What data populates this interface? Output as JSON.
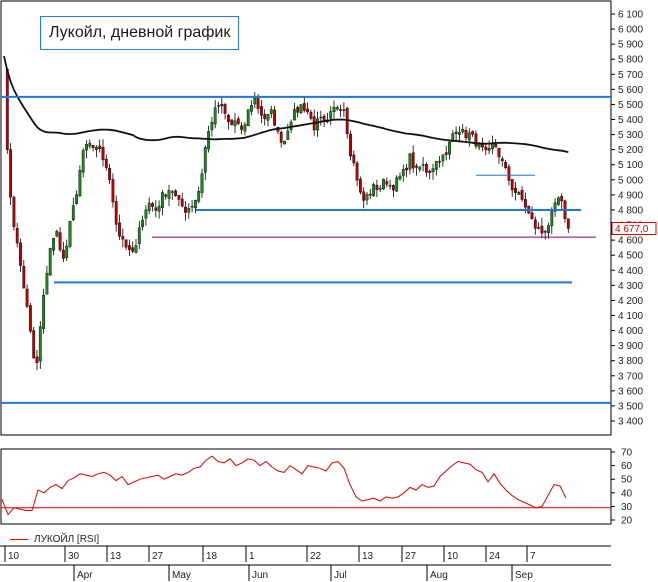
{
  "chart_data": {
    "type": "candlestick",
    "title": "Лукойл, дневной график",
    "price_axis": {
      "ylim": [
        3400,
        6100
      ],
      "ticks": [
        "6 100",
        "6 000",
        "5 900",
        "5 800",
        "5 700",
        "5 600",
        "5 500",
        "5 400",
        "5 300",
        "5 200",
        "5 100",
        "5 000",
        "4 900",
        "4 800",
        "4 700",
        "4 600",
        "4 500",
        "4 400",
        "4 300",
        "4 200",
        "4 100",
        "4 000",
        "3 900",
        "3 800",
        "3 700",
        "3 600",
        "3 500",
        "3 400"
      ],
      "last_price_label": "4 677,0",
      "last_price": 4677
    },
    "rsi_axis": {
      "ylim": [
        20,
        70
      ],
      "ticks": [
        "70",
        "60",
        "50",
        "40",
        "30",
        "20"
      ],
      "level": 29
    },
    "date_axis": {
      "day_labels": [
        "10",
        "30",
        "13",
        "27",
        "18",
        "1",
        "22",
        "13",
        "27",
        "10",
        "24",
        "7"
      ],
      "month_labels": [
        "Apr",
        "May",
        "Jun",
        "Jul",
        "Aug",
        "Sep"
      ]
    },
    "legend": "ЛУКОЙЛ [RSI]",
    "horizontal_levels": [
      5550,
      4800,
      4320,
      3520
    ],
    "short_levels": [
      5030,
      4620
    ],
    "colors": {
      "up": "#1a8a1a",
      "down": "#c00000",
      "level": "#1f78d1",
      "ma": "#111111",
      "rsi": "#e00000",
      "last": "#800060"
    }
  }
}
